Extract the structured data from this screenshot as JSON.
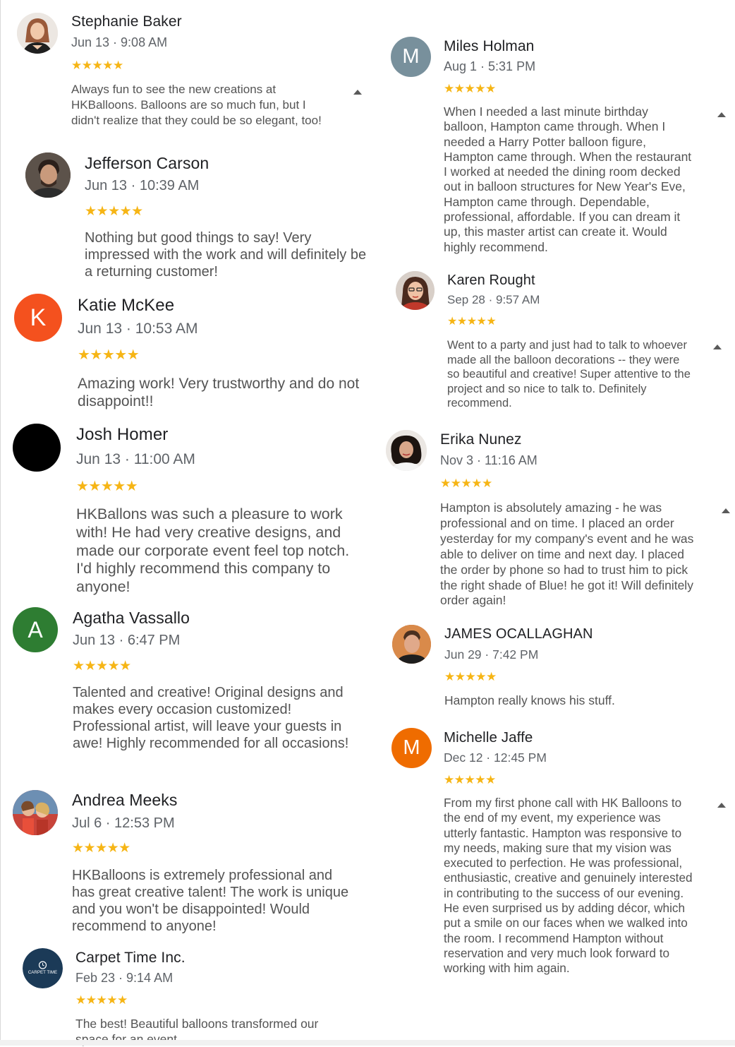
{
  "reviews": {
    "stephanie": {
      "name": "Stephanie Baker",
      "meta": "Jun 13 · 9:08 AM",
      "stars": "★★★★★",
      "text": "Always fun to see the new creations at HKBalloons.  Balloons are so much fun, but I didn't realize that they could be so elegant, too!",
      "avatar": "profile-photo"
    },
    "jefferson": {
      "name": "Jefferson Carson",
      "meta": "Jun 13 · 10:39 AM",
      "stars": "★★★★★",
      "text": "Nothing but good things to say! Very impressed with the work and will definitely be a returning customer!",
      "avatar": "profile-photo"
    },
    "katie": {
      "name": "Katie McKee",
      "meta": "Jun 13 · 10:53 AM",
      "stars": "★★★★★",
      "text": "Amazing work! Very trustworthy and do not disappoint!!",
      "initial": "K",
      "color": "#f4511e"
    },
    "josh": {
      "name": "Josh Homer",
      "meta": "Jun 13 · 11:00 AM",
      "stars": "★★★★★",
      "text": "HKBallons was such a pleasure to work with! He had very creative designs, and made our corporate event feel top notch. I'd highly recommend this company to anyone!",
      "color": "#000000"
    },
    "agatha": {
      "name": "Agatha Vassallo",
      "meta": "Jun 13 · 6:47 PM",
      "stars": "★★★★★",
      "text": "Talented and creative! Original designs and makes every occasion customized! Professional artist, will leave your guests in awe! Highly recommended for all occasions!",
      "initial": "A",
      "color": "#2e7d32"
    },
    "andrea": {
      "name": "Andrea Meeks",
      "meta": "Jul 6 · 12:53 PM",
      "stars": "★★★★★",
      "text": "HKBalloons is extremely professional and has great creative talent! The work is unique and you won't be disappointed! Would recommend to anyone!",
      "avatar": "profile-photo"
    },
    "carpet": {
      "name": "Carpet Time Inc.",
      "meta": "Feb 23 · 9:14 AM",
      "stars": "★★★★★",
      "text": "The best!  Beautiful balloons transformed our space for an event.",
      "logo_text": "CARPET TIME",
      "color": "#1b3a57"
    },
    "miles": {
      "name": "Miles Holman",
      "meta": "Aug 1 · 5:31 PM",
      "stars": "★★★★★",
      "text": "When I needed a last minute birthday balloon, Hampton came through. When I needed a Harry Potter balloon figure, Hampton came through. When the restaurant I worked at needed the dining room decked out in balloon structures for New Year's Eve, Hampton came through. Dependable, professional, affordable. If you can dream it up, this master artist can create it. Would highly recommend.",
      "initial": "M",
      "color": "#78909c"
    },
    "karen": {
      "name": "Karen Rought",
      "meta": "Sep 28 · 9:57 AM",
      "stars": "★★★★★",
      "text": "Went to a party and just had to talk to whoever made all the balloon decorations -- they were so beautiful and creative! Super attentive to the project and so nice to talk to. Definitely recommend.",
      "avatar": "profile-photo"
    },
    "erika": {
      "name": "Erika Nunez",
      "meta": "Nov 3 · 11:16 AM",
      "stars": "★★★★★",
      "text": "Hampton is absolutely amazing - he was professional and on time. I placed an order yesterday for my company's event and he was able to deliver on time and next day. I placed the order by phone so had to trust him to pick the right shade of Blue! he got it! Will definitely order again!",
      "avatar": "profile-photo"
    },
    "james": {
      "name": "JAMES OCALLAGHAN",
      "meta": "Jun 29 · 7:42 PM",
      "stars": "★★★★★",
      "text": "Hampton really knows his stuff.",
      "avatar": "profile-photo"
    },
    "michelle": {
      "name": "Michelle Jaffe",
      "meta": "Dec 12 · 12:45 PM",
      "stars": "★★★★★",
      "text": "From my first phone call with HK Balloons to the end of my event, my experience was utterly fantastic. Hampton was responsive to my needs, making sure that my vision was executed to perfection. He was professional, enthusiastic, creative and genuinely interested in contributing to the success of our evening. He even surprised us by adding décor, which put a smile on our faces when we walked into the room. I recommend Hampton without reservation and very much look forward to working with him again.",
      "initial": "M",
      "color": "#ef6c00"
    }
  }
}
